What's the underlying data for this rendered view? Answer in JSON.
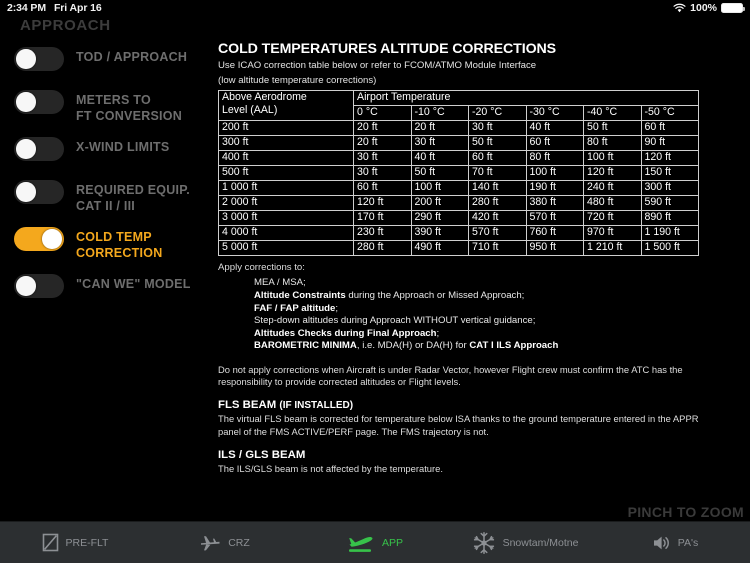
{
  "status_bar": {
    "time": "2:34 PM",
    "date": "Fri Apr 16",
    "wifi_icon": "wifi-icon",
    "battery_percent": "100%",
    "battery_icon": "battery-full-icon"
  },
  "sidebar": {
    "title": "APPROACH",
    "items": [
      {
        "label": "TOD / APPROACH",
        "active": false
      },
      {
        "label": "METERS TO\nFT CONVERSION",
        "active": false
      },
      {
        "label": "X-WIND LIMITS",
        "active": false
      },
      {
        "label": "REQUIRED EQUIP.\nCAT II / III",
        "active": false
      },
      {
        "label": "COLD TEMP\nCORRECTION",
        "active": true
      },
      {
        "label": "\"CAN WE\" MODEL",
        "active": false
      }
    ],
    "accent_color": "#f4a81d",
    "inactive_label_color": "#6e6e6e"
  },
  "main": {
    "title": "COLD TEMPERATURES ALTITUDE CORRECTIONS",
    "subtitle_line_1": "Use ICAO correction table below or refer to FCOM/ATMO Module Interface",
    "subtitle_line_2": "(low altitude temperature corrections)",
    "table": {
      "group_header_left": "Above Aerodrome\nLevel (AAL)",
      "group_header_right": "Airport Temperature",
      "columns": [
        "0 °C",
        "-10 °C",
        "-20 °C",
        "-30 °C",
        "-40 °C",
        "-50 °C"
      ],
      "rows": [
        {
          "aal": "200 ft",
          "values": [
            "20 ft",
            "20 ft",
            "30 ft",
            "40 ft",
            "50 ft",
            "60 ft"
          ]
        },
        {
          "aal": "300 ft",
          "values": [
            "20 ft",
            "30 ft",
            "50 ft",
            "60 ft",
            "80 ft",
            "90 ft"
          ]
        },
        {
          "aal": "400 ft",
          "values": [
            "30 ft",
            "40 ft",
            "60 ft",
            "80 ft",
            "100 ft",
            "120 ft"
          ]
        },
        {
          "aal": "500 ft",
          "values": [
            "30 ft",
            "50 ft",
            "70 ft",
            "100 ft",
            "120 ft",
            "150 ft"
          ]
        },
        {
          "aal": "1 000 ft",
          "values": [
            "60 ft",
            "100 ft",
            "140 ft",
            "190 ft",
            "240 ft",
            "300 ft"
          ]
        },
        {
          "aal": "2 000 ft",
          "values": [
            "120 ft",
            "200 ft",
            "280 ft",
            "380 ft",
            "480 ft",
            "590 ft"
          ]
        },
        {
          "aal": "3 000 ft",
          "values": [
            "170 ft",
            "290 ft",
            "420 ft",
            "570 ft",
            "720 ft",
            "890 ft"
          ]
        },
        {
          "aal": "4 000 ft",
          "values": [
            "230 ft",
            "390 ft",
            "570 ft",
            "760 ft",
            "970 ft",
            "1 190 ft"
          ]
        },
        {
          "aal": "5 000 ft",
          "values": [
            "280 ft",
            "490 ft",
            "710 ft",
            "950 ft",
            "1 210 ft",
            "1 500 ft"
          ]
        }
      ]
    },
    "apply_heading": "Apply corrections to:",
    "apply_items": [
      {
        "bold": "",
        "rest": "MEA / MSA;"
      },
      {
        "bold": "Altitude Constraints",
        "rest": " during the Approach or Missed Approach;"
      },
      {
        "bold": "FAF / FAP altitude",
        "rest": ";"
      },
      {
        "bold": "",
        "rest": "Step-down altitudes during Approach WITHOUT vertical guidance;"
      },
      {
        "bold": "Altitudes Checks during Final Approach",
        "rest": ";"
      },
      {
        "bold": "BAROMETRIC MINIMA",
        "rest": ", i.e. MDA(H) or DA(H) for ",
        "bold2": "CAT I ILS Approach"
      }
    ],
    "radar_note": "Do not apply corrections when Aircraft is under Radar Vector, however Flight crew must confirm the ATC has the responsibility to provide corrected altitudes or Flight levels.",
    "fls_heading": "FLS BEAM",
    "fls_heading_note": "(IF INSTALLED)",
    "fls_body": "The virtual FLS beam is corrected for temperature below ISA thanks to the ground temperature entered in the APPR panel of the FMS ACTIVE/PERF page. The FMS trajectory is not.",
    "ils_heading": "ILS / GLS BEAM",
    "ils_body": "The ILS/GLS beam is not affected by the temperature."
  },
  "pinch_hint": "PINCH TO ZOOM",
  "tabbar": {
    "active_color": "#37c24a",
    "inactive_color": "#8d9094",
    "tabs": [
      {
        "label": "PRE-FLT",
        "icon": "checklist-icon",
        "active": false
      },
      {
        "label": "CRZ",
        "icon": "airplane-icon",
        "active": false
      },
      {
        "label": "APP",
        "icon": "plane-landing-icon",
        "active": true
      },
      {
        "label": "Snowtam/Motne",
        "icon": "snowflake-icon",
        "active": false
      },
      {
        "label": "PA's",
        "icon": "speaker-icon",
        "active": false
      }
    ]
  }
}
